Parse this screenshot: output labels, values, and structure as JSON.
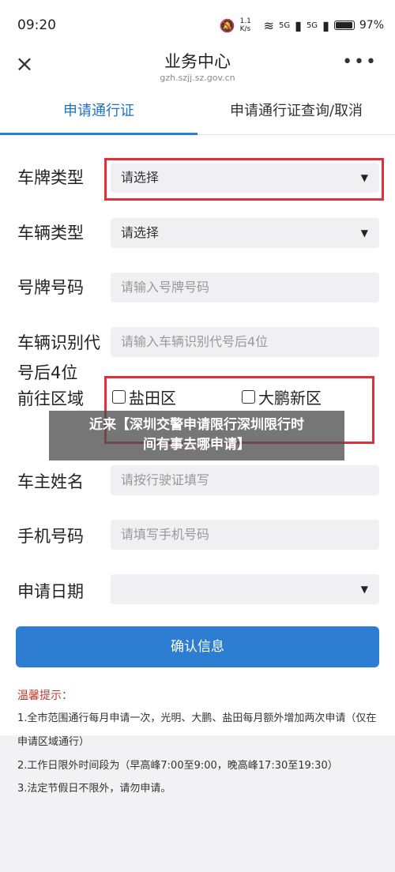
{
  "status_bar": {
    "time": "09:20",
    "speed": "1.1 K/s",
    "signal_1": "5G",
    "signal_2": "5G",
    "battery": "97%"
  },
  "app_bar": {
    "title": "业务中心",
    "url": "gzh.szjj.sz.gov.cn",
    "close_icon": "×",
    "more_icon": "•••"
  },
  "tabs": [
    {
      "label": "申请通行证"
    },
    {
      "label": "申请通行证查询/取消"
    }
  ],
  "form": {
    "plate_type": {
      "label": "车牌类型",
      "value": "请选择"
    },
    "vehicle_type": {
      "label": "车辆类型",
      "value": "请选择"
    },
    "plate_number": {
      "label": "号牌号码",
      "placeholder": "请输入号牌号码"
    },
    "vin": {
      "label_line1": "车辆识别代",
      "label_line2": "号后4位",
      "placeholder": "请输入车辆识别代号后4位"
    },
    "area": {
      "label": "前往区域",
      "options": [
        "盐田区",
        "大鹏新区"
      ]
    },
    "owner": {
      "label": "车主姓名",
      "placeholder": "请按行驶证填写"
    },
    "phone": {
      "label": "手机号码",
      "placeholder": "请填写手机号码"
    },
    "date": {
      "label": "申请日期"
    }
  },
  "overlay_caption": {
    "line1": "近来【深圳交警申请限行深圳限行时",
    "line2": "间有事去哪申请】"
  },
  "confirm_button": "确认信息",
  "tips": {
    "title": "温馨提示：",
    "items": [
      "1.全市范围通行每月申请一次，光明、大鹏、盐田每月额外增加两次申请（仅在申请区域通行）",
      "2.工作日限外时间段为（早高峰7:00至9:00，晚高峰17:30至19:30）",
      "3.法定节假日不限外，请勿申请。"
    ]
  },
  "colors": {
    "accent": "#2d7ed3",
    "highlight": "#e0303a",
    "tip_title": "#c0392b"
  }
}
